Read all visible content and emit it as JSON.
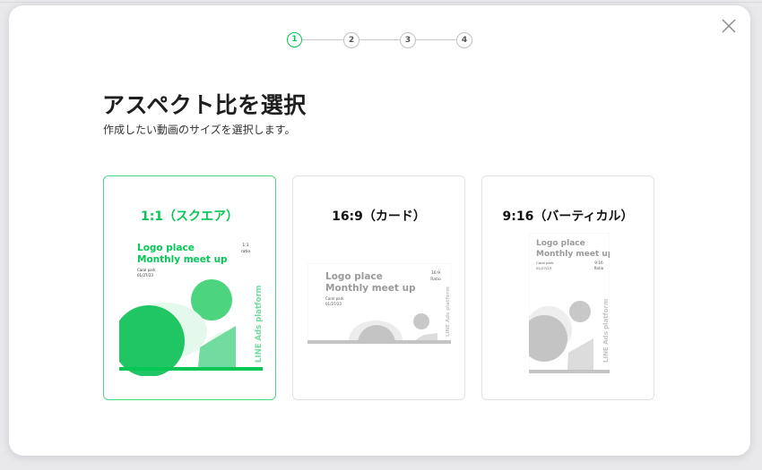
{
  "modal": {
    "title": "アスペクト比を選択",
    "subtitle": "作成したい動画のサイズを選択します。"
  },
  "stepper": {
    "steps": [
      "1",
      "2",
      "3",
      "4"
    ],
    "active_step": 1
  },
  "options": [
    {
      "label": "1:1（スクエア）",
      "selected": true,
      "preview": {
        "logo": "Logo place",
        "event": "Monthly meet up",
        "venue": "Carol park",
        "date": "01/27/23",
        "ratio_value": "1:1",
        "ratio_word": "ratio",
        "brand": "LINE Ads platform"
      }
    },
    {
      "label": "16:9（カード）",
      "selected": false,
      "preview": {
        "logo": "Logo place",
        "event": "Monthly meet up",
        "venue": "Carol park",
        "date": "01/27/23",
        "ratio_value": "16:9",
        "ratio_word": "Ratio",
        "brand": "LINE Ads platform"
      }
    },
    {
      "label": "9:16（バーティカル）",
      "selected": false,
      "preview": {
        "logo": "Logo place",
        "event": "Monthly meet up",
        "venue": "Carol park",
        "date": "01/27/23",
        "ratio_value": "9:16",
        "ratio_word": "Ratio",
        "brand": "LINE Ads platform"
      }
    }
  ],
  "colors": {
    "accent": "#06c755",
    "accent_light": "#4cd47f",
    "accent_pale": "#72dba0",
    "inactive_shape": "#c4c4c4",
    "inactive_shape_light": "#dedede"
  },
  "icons": {
    "close": "close-icon"
  }
}
